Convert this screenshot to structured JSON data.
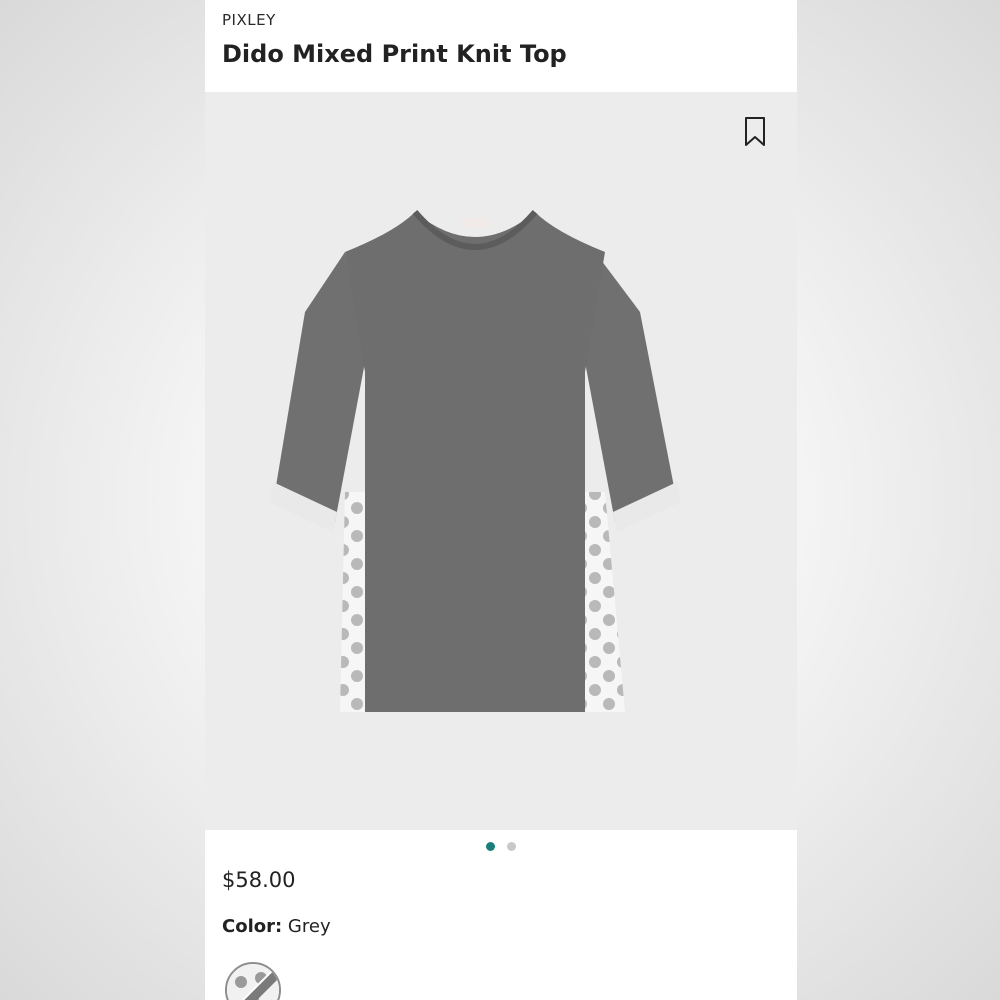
{
  "product": {
    "brand": "PIXLEY",
    "title": "Dido Mixed Print Knit Top",
    "price": "$58.00",
    "color_label": "Color:",
    "color_value": "Grey"
  },
  "gallery": {
    "image_count": 2,
    "active_index": 0
  },
  "icons": {
    "bookmark": "bookmark-icon"
  },
  "colors": {
    "accent": "#1a7f7a",
    "inactive_dot": "#c8c8c8",
    "image_bg": "#ececed",
    "knit_grey": "#6e6e6e",
    "chiffon": "#f6f6f6"
  }
}
